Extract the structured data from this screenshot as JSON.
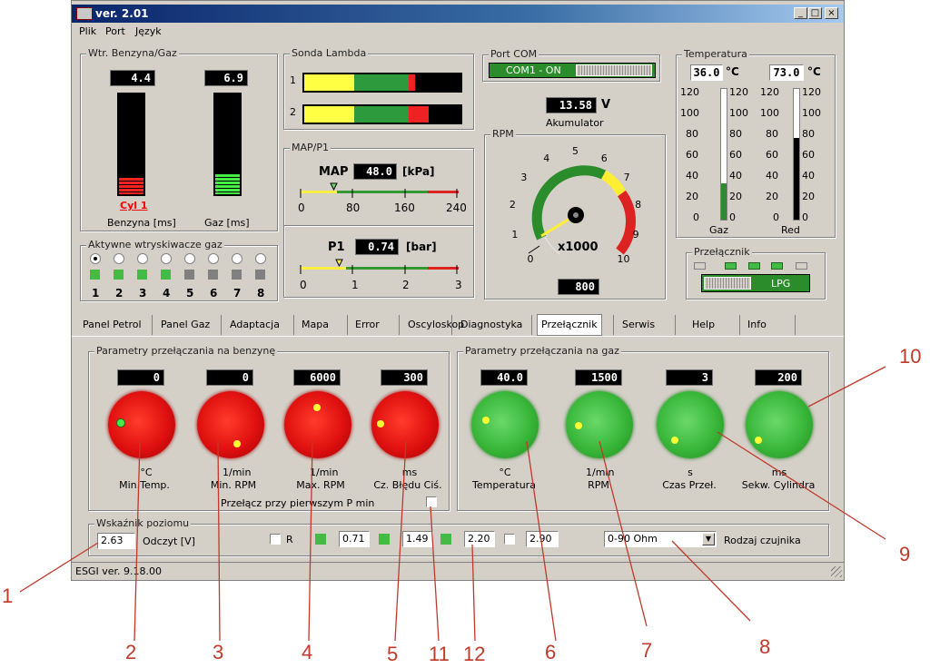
{
  "window": {
    "title": "ver. 2.01"
  },
  "menu": [
    "Plik",
    "Port",
    "Język"
  ],
  "wtr": {
    "label": "Wtr. Benzyna/Gaz",
    "benzyna_value": "4.4",
    "gaz_value": "6.9",
    "cyl_label": "Cyl 1",
    "benzyna_label": "Benzyna [ms]",
    "gaz_label": "Gaz [ms]"
  },
  "injectors": {
    "label": "Aktywne wtryskiwacze gaz",
    "numbers": [
      "1",
      "2",
      "3",
      "4",
      "5",
      "6",
      "7",
      "8"
    ]
  },
  "lambda": {
    "label": "Sonda Lambda",
    "rows": [
      "1",
      "2"
    ]
  },
  "map": {
    "group_label": "MAP/P1",
    "map_label": "MAP",
    "map_value": "48.0",
    "map_unit": "[kPa]",
    "map_ticks": [
      "0",
      "80",
      "160",
      "240"
    ],
    "p1_label": "P1",
    "p1_value": "0.74",
    "p1_unit": "[bar]",
    "p1_ticks": [
      "0",
      "1",
      "2",
      "3"
    ]
  },
  "port": {
    "label": "Port COM",
    "status": "COM1 - ON"
  },
  "akumulator": {
    "value": "13.58",
    "unit": "V",
    "label": "Akumulator"
  },
  "rpm": {
    "label": "RPM",
    "ticks": [
      "0",
      "1",
      "2",
      "3",
      "4",
      "5",
      "6",
      "7",
      "8",
      "9",
      "10"
    ],
    "multiplier": "x1000",
    "value": "800"
  },
  "temperatura": {
    "label": "Temperatura",
    "gaz_value": "36.0",
    "red_value": "73.0",
    "unit": "°C",
    "scale": [
      "120",
      "100",
      "80",
      "60",
      "40",
      "20",
      "0"
    ],
    "gaz_label": "Gaz",
    "red_label": "Red"
  },
  "przelacznik": {
    "label": "Przełącznik",
    "button": "LPG"
  },
  "tabs": [
    "Panel Petrol",
    "Panel Gaz",
    "Adaptacja",
    "Mapa",
    "Error",
    "Oscyloskop",
    "Diagnostyka",
    "Przełącznik",
    "Serwis",
    "Help",
    "Info"
  ],
  "benzyna_params": {
    "label": "Parametry przełączania na benzynę",
    "knobs": [
      {
        "value": "0",
        "unit": "°C",
        "name": "Min.Temp."
      },
      {
        "value": "0",
        "unit": "1/min",
        "name": "Min. RPM"
      },
      {
        "value": "6000",
        "unit": "1/min",
        "name": "Max. RPM"
      },
      {
        "value": "300",
        "unit": "ms",
        "name": "Cz. Błędu Ciś."
      }
    ],
    "checkbox_label": "Przełącz przy pierwszym P min"
  },
  "gaz_params": {
    "label": "Parametry przełączania na gaz",
    "knobs": [
      {
        "value": "40.0",
        "unit": "°C",
        "name": "Temperatura"
      },
      {
        "value": "1500",
        "unit": "1/min",
        "name": "RPM"
      },
      {
        "value": "3",
        "unit": "s",
        "name": "Czas Przeł."
      },
      {
        "value": "200",
        "unit": "ms",
        "name": "Sekw. Cylindra"
      }
    ]
  },
  "poziom": {
    "label": "Wskaźnik poziomu",
    "reading": "2.63",
    "reading_label": "Odczyt [V]",
    "r_label": "R",
    "levels": [
      "0.71",
      "1.49",
      "2.20",
      "2.90"
    ],
    "sensor_value": "0-90 Ohm",
    "sensor_label": "Rodzaj czujnika"
  },
  "status": {
    "text": "ESGI ver. 9.18.00"
  },
  "callouts": [
    "1",
    "2",
    "3",
    "4",
    "5",
    "11",
    "12",
    "6",
    "7",
    "8",
    "9",
    "10"
  ],
  "colors": {
    "red_knob": "#e01010",
    "green_knob": "#39b739",
    "lcd": "#000000",
    "callout": "#c0392b"
  }
}
